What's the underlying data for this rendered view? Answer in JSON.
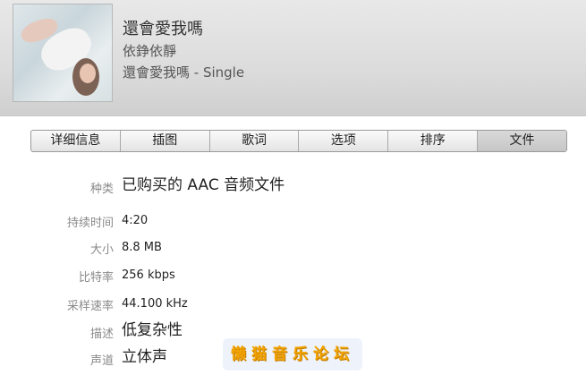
{
  "header": {
    "song_title": "還會愛我嗎",
    "artist": "依錚依靜",
    "album": "還會愛我嗎 - Single"
  },
  "tabs": [
    "详细信息",
    "插图",
    "歌词",
    "选项",
    "排序",
    "文件"
  ],
  "active_tab": "文件",
  "details": [
    {
      "label": "种类",
      "value": "已购买的 AAC 音频文件"
    },
    {
      "label": "持续时间",
      "value": "4:20"
    },
    {
      "label": "大小",
      "value": "8.8 MB"
    },
    {
      "label": "比特率",
      "value": "256 kbps"
    },
    {
      "label": "采样速率",
      "value": "44.100 kHz"
    },
    {
      "label": "描述",
      "value": "低复杂性"
    },
    {
      "label": "声道",
      "value": "立体声"
    }
  ],
  "watermark": "懒猫音乐论坛"
}
